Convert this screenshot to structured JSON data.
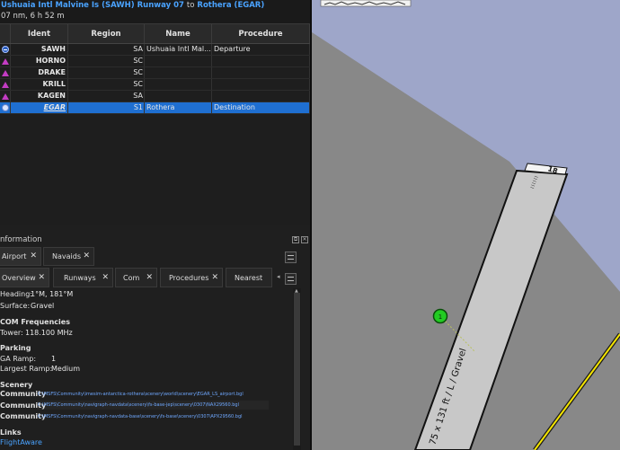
{
  "route": {
    "from": "Ushuaia Intl Malvine Is (SAWH) Runway 07",
    "to_word": "to",
    "to": "Rothera (EGAR)",
    "summary": "07 nm, 6 h 52 m"
  },
  "flightplan": {
    "columns": [
      "Ident",
      "Region",
      "Name",
      "Procedure"
    ],
    "rows": [
      {
        "icon": "airport-departure-icon",
        "ident": "SAWH",
        "region": "SA",
        "name": "Ushuaia Intl Mal...",
        "procedure": "Departure"
      },
      {
        "icon": "waypoint-icon",
        "ident": "HORNO",
        "region": "SC",
        "name": "",
        "procedure": ""
      },
      {
        "icon": "waypoint-icon",
        "ident": "DRAKE",
        "region": "SC",
        "name": "",
        "procedure": ""
      },
      {
        "icon": "waypoint-icon",
        "ident": "KRILL",
        "region": "SC",
        "name": "",
        "procedure": ""
      },
      {
        "icon": "waypoint-icon",
        "ident": "KAGEN",
        "region": "SA",
        "name": "",
        "procedure": ""
      },
      {
        "icon": "airport-icon",
        "ident": "EGAR",
        "region": "S1",
        "name": "Rothera",
        "procedure": "Destination"
      }
    ]
  },
  "info": {
    "title": "nformation",
    "tabs": [
      {
        "label": "Airport"
      },
      {
        "label": "Navaids"
      }
    ],
    "subtabs": [
      {
        "label": "Overview"
      },
      {
        "label": "Runways"
      },
      {
        "label": "Com"
      },
      {
        "label": "Procedures"
      },
      {
        "label": "Nearest"
      }
    ],
    "heading_label": "Heading:",
    "heading_value": "1°M, 181°M",
    "surface_label": "Surface:",
    "surface_value": "Gravel",
    "com_header": "COM Frequencies",
    "tower_label": "Tower:",
    "tower_value": "118.100 MHz",
    "parking_header": "Parking",
    "ga_ramp_label": "GA Ramp:",
    "ga_ramp_value": "1",
    "largest_ramp_label": "Largest Ramp:",
    "largest_ramp_value": "Medium",
    "scenery_header": "Scenery",
    "scenery": [
      {
        "label": "Community",
        "path": "C:\\MSFS\\Community\\imesim-antarctica-rothera\\scenery\\world\\scenery\\EGAR_LS_airport.bgl"
      },
      {
        "label": "Community",
        "path": "C:\\MSFS\\Community\\navigraph-navdata\\scenery\\fs-base-jep\\scenery\\0307\\NAX29560.bgl"
      },
      {
        "label": "Community",
        "path": "C:\\MSFS\\Community\\navigraph-navdata-base\\scenery\\fs-base\\scenery\\0307\\APX29560.bgl"
      }
    ],
    "links_header": "Links",
    "links": [
      {
        "label": "FlightAware"
      }
    ]
  },
  "map": {
    "runway_label": "75 x 131 ft / L / Gravel",
    "runway_end_a": "18",
    "marker_number": "1",
    "colors": {
      "background": "#888888",
      "land": "#9ea6c9",
      "runway": "#c8c8c8",
      "marker": "#22cc22",
      "route": "#f5e500"
    }
  }
}
